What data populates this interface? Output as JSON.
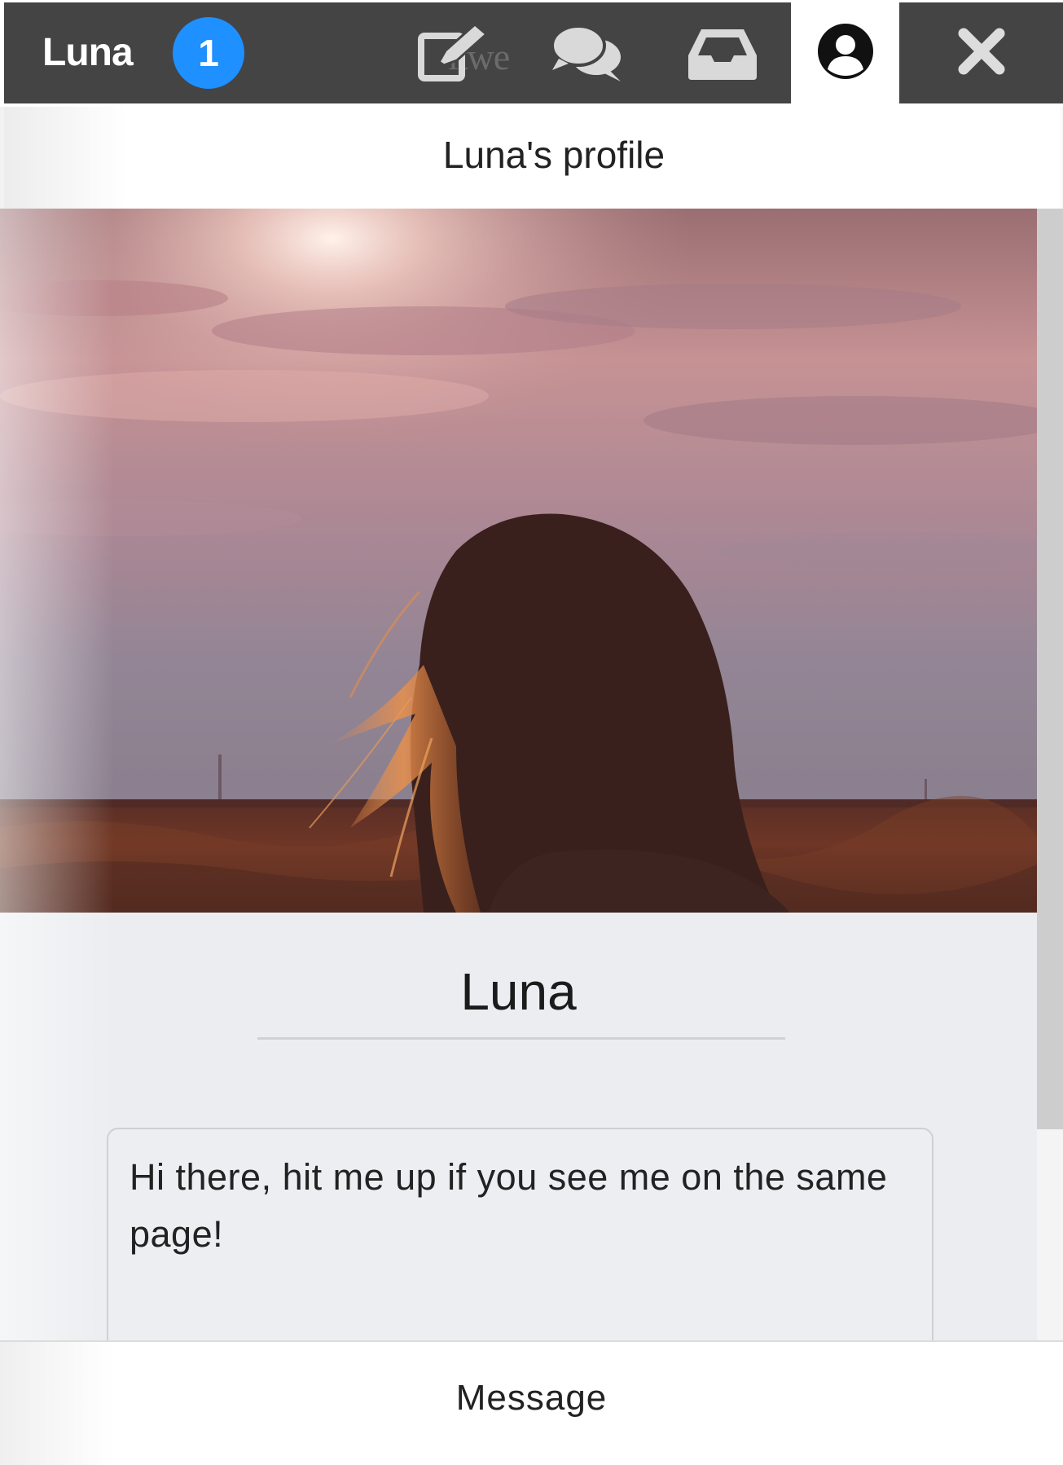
{
  "topbar": {
    "name": "Luna",
    "badge_count": "1",
    "ghost_text": "itwe",
    "icons": [
      "edit-icon",
      "chat-bubbles-icon",
      "inbox-icon",
      "user-circle-icon",
      "close-icon"
    ]
  },
  "panel": {
    "title": "Luna's profile"
  },
  "profile": {
    "name": "Luna",
    "bio": "Hi there, hit me up if you see me on the same page!",
    "cover_image": "woman-silhouette-sunset-field"
  },
  "footer": {
    "message_label": "Message"
  },
  "colors": {
    "bar": "#444444",
    "badge": "#1e90ff",
    "content_bg": "#ebedf0"
  }
}
